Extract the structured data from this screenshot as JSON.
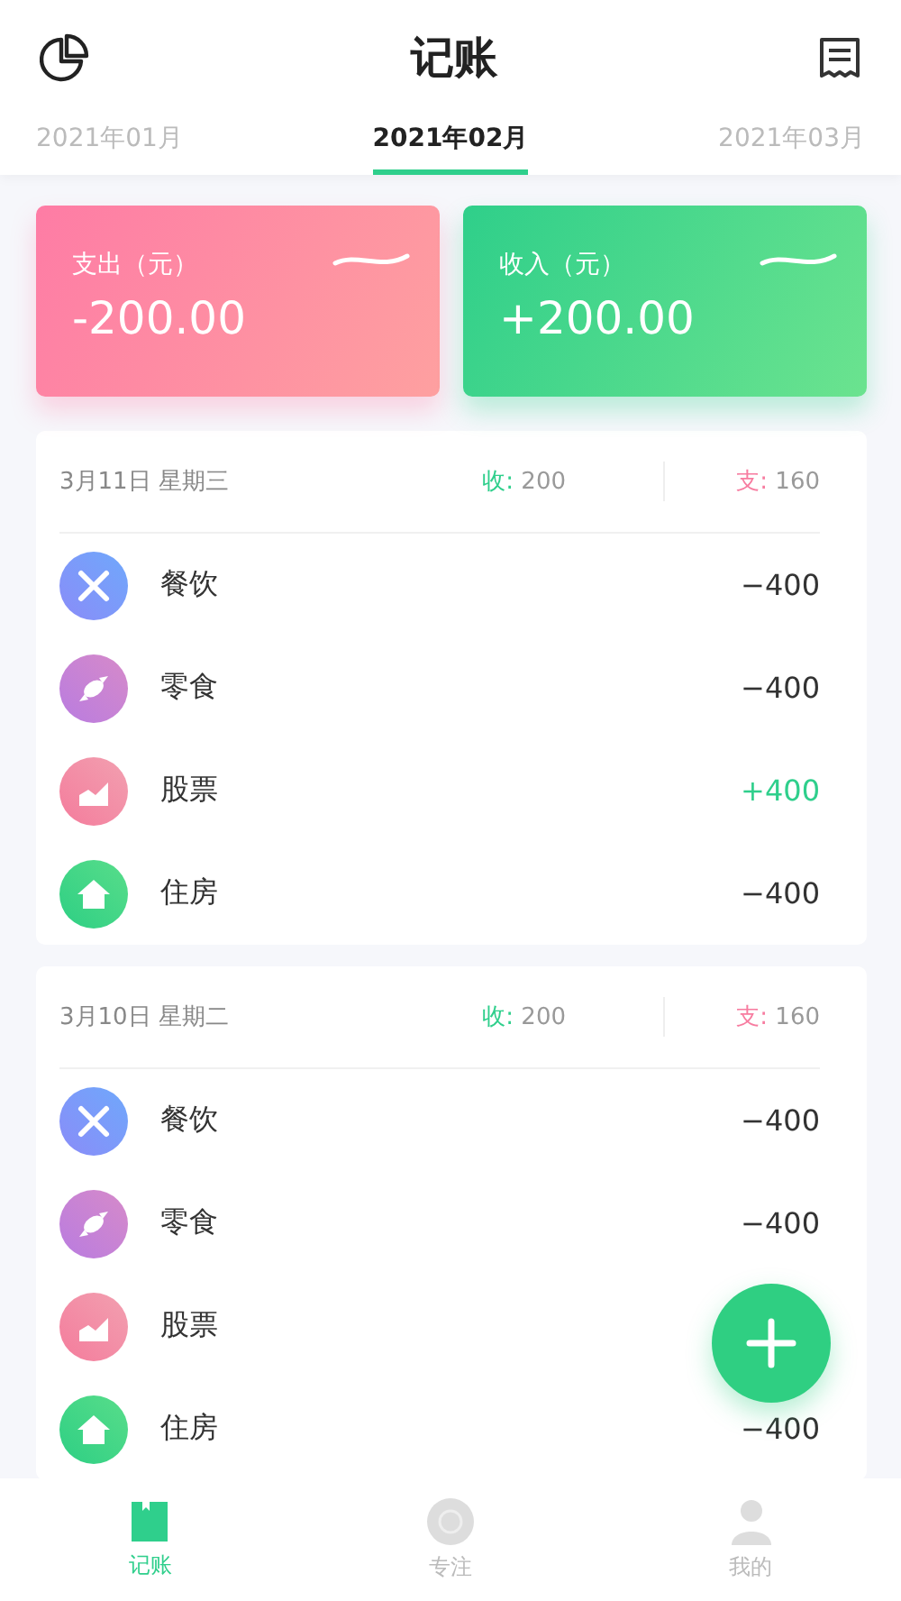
{
  "header": {
    "title": "记账"
  },
  "months": [
    {
      "label": "2021年01月",
      "selected": false
    },
    {
      "label": "2021年02月",
      "selected": true
    },
    {
      "label": "2021年03月",
      "selected": false
    }
  ],
  "summary": [
    {
      "kind": "expense",
      "label": "支出（元）",
      "amount": "-200.00"
    },
    {
      "kind": "income",
      "label": "收入（元）",
      "amount": "+200.00"
    }
  ],
  "days": [
    {
      "date": "3月11日 星期三",
      "income_label": "收:",
      "income": "200",
      "expense_label": "支:",
      "expense": "160",
      "entries": [
        {
          "kind": "dining",
          "category": "餐饮",
          "income": false,
          "amount": "−400"
        },
        {
          "kind": "snack",
          "category": "零食",
          "income": false,
          "amount": "−400"
        },
        {
          "kind": "stock",
          "category": "股票",
          "income": true,
          "amount": "+400"
        },
        {
          "kind": "housing",
          "category": "住房",
          "income": false,
          "amount": "−400"
        }
      ]
    },
    {
      "date": "3月10日 星期二",
      "income_label": "收:",
      "income": "200",
      "expense_label": "支:",
      "expense": "160",
      "entries": [
        {
          "kind": "dining",
          "category": "餐饮",
          "income": false,
          "amount": "−400"
        },
        {
          "kind": "snack",
          "category": "零食",
          "income": false,
          "amount": "−400"
        },
        {
          "kind": "stock",
          "category": "股票"
        },
        {
          "kind": "housing",
          "category": "住房",
          "income": false,
          "amount": "−400"
        }
      ]
    }
  ],
  "nav": [
    {
      "kind": "book",
      "label": "记账",
      "selected": true
    },
    {
      "kind": "focus",
      "label": "专注",
      "selected": false
    },
    {
      "kind": "me",
      "label": "我的",
      "selected": false
    }
  ]
}
